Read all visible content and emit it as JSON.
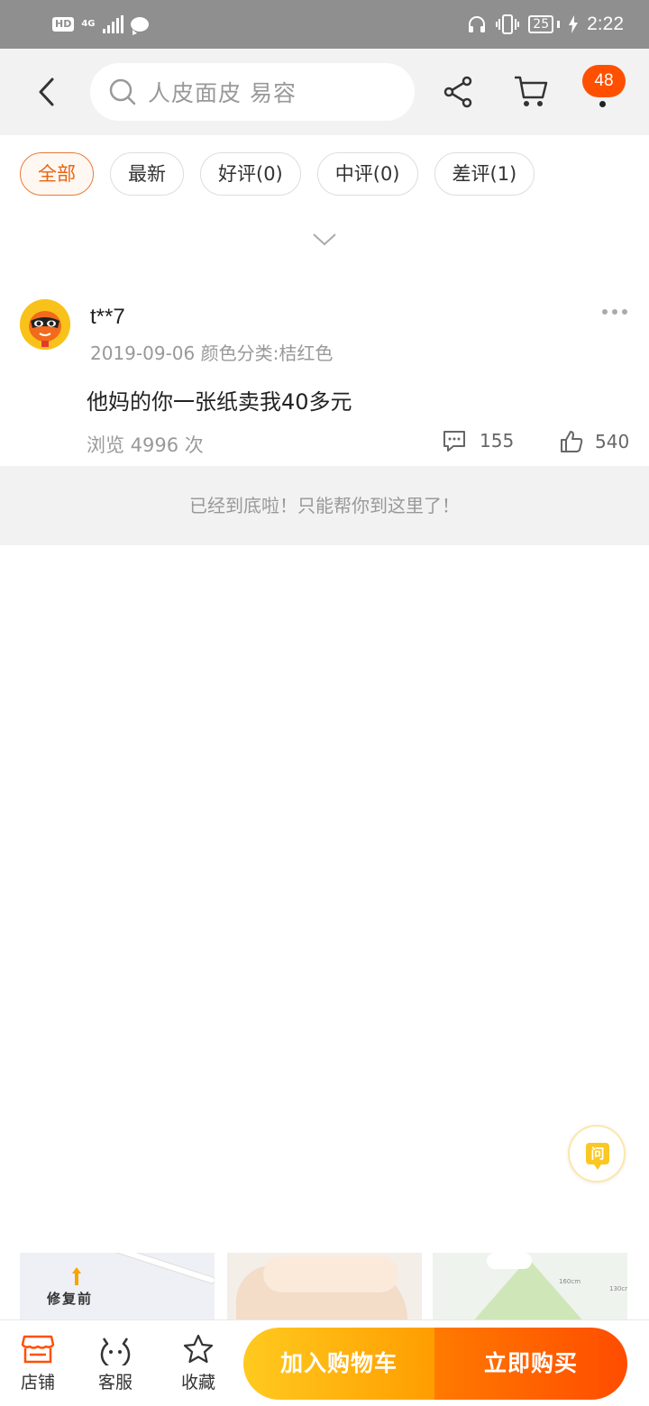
{
  "status_bar": {
    "hd": "HD",
    "network": "4G",
    "battery": "25",
    "time": "2:22"
  },
  "top_nav": {
    "search_placeholder": "人皮面皮 易容",
    "message_badge": "48"
  },
  "filters": [
    {
      "label": "全部",
      "active": true
    },
    {
      "label": "最新",
      "active": false
    },
    {
      "label": "好评(0)",
      "active": false
    },
    {
      "label": "中评(0)",
      "active": false
    },
    {
      "label": "差评(1)",
      "active": false
    }
  ],
  "review": {
    "username": "t**7",
    "meta": "2019-09-06 颜色分类:桔红色",
    "text": "他妈的你一张纸卖我40多元",
    "views": "浏览 4996 次",
    "comments": "155",
    "likes": "540"
  },
  "end_message": "已经到底啦！只能帮你到这里了！",
  "ask_button": "问",
  "thumbnails": {
    "t1_label": "修复前",
    "t3_size_a": "160cm",
    "t3_size_b": "130cm"
  },
  "bottom_bar": {
    "store": "店铺",
    "service": "客服",
    "favorite": "收藏",
    "add_to_cart": "加入购物车",
    "buy_now": "立即购买"
  },
  "colors": {
    "accent_orange": "#ff5000",
    "cart_yellow": "#ffca1f",
    "active_chip": "#e8650f"
  }
}
